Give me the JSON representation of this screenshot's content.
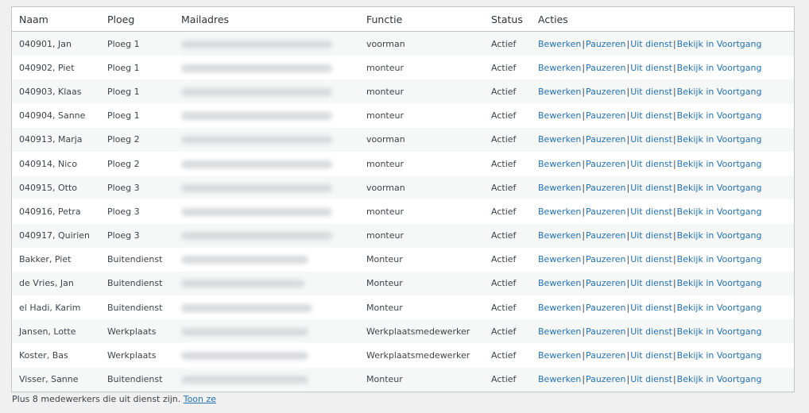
{
  "table": {
    "headers": {
      "naam": "Naam",
      "ploeg": "Ploeg",
      "mail": "Mailadres",
      "functie": "Functie",
      "status": "Status",
      "acties": "Acties"
    },
    "actions": {
      "edit": "Bewerken",
      "pause": "Pauzeren",
      "retire": "Uit dienst",
      "view": "Bekijk in Voortgang",
      "separator": "|"
    },
    "rows": [
      {
        "naam": "040901, Jan",
        "ploeg": "Ploeg 1",
        "functie": "voorman",
        "status": "Actief"
      },
      {
        "naam": "040902, Piet",
        "ploeg": "Ploeg 1",
        "functie": "monteur",
        "status": "Actief"
      },
      {
        "naam": "040903, Klaas",
        "ploeg": "Ploeg 1",
        "functie": "monteur",
        "status": "Actief"
      },
      {
        "naam": "040904, Sanne",
        "ploeg": "Ploeg 1",
        "functie": "monteur",
        "status": "Actief"
      },
      {
        "naam": "040913, Marja",
        "ploeg": "Ploeg 2",
        "functie": "voorman",
        "status": "Actief"
      },
      {
        "naam": "040914, Nico",
        "ploeg": "Ploeg 2",
        "functie": "monteur",
        "status": "Actief"
      },
      {
        "naam": "040915, Otto",
        "ploeg": "Ploeg 3",
        "functie": "voorman",
        "status": "Actief"
      },
      {
        "naam": "040916, Petra",
        "ploeg": "Ploeg 3",
        "functie": "monteur",
        "status": "Actief"
      },
      {
        "naam": "040917, Quirien",
        "ploeg": "Ploeg 3",
        "functie": "monteur",
        "status": "Actief"
      },
      {
        "naam": "Bakker, Piet",
        "ploeg": "Buitendienst",
        "functie": "Monteur",
        "status": "Actief"
      },
      {
        "naam": "de Vries, Jan",
        "ploeg": "Buitendienst",
        "functie": "Monteur",
        "status": "Actief"
      },
      {
        "naam": "el Hadi, Karim",
        "ploeg": "Buitendienst",
        "functie": "Monteur",
        "status": "Actief"
      },
      {
        "naam": "Jansen, Lotte",
        "ploeg": "Werkplaats",
        "functie": "Werkplaatsmedewerker",
        "status": "Actief"
      },
      {
        "naam": "Koster, Bas",
        "ploeg": "Werkplaats",
        "functie": "Werkplaatsmedewerker",
        "status": "Actief"
      },
      {
        "naam": "Visser, Sanne",
        "ploeg": "Buitendienst",
        "functie": "Monteur",
        "status": "Actief"
      }
    ]
  },
  "footer": {
    "text": "Plus 8 medewerkers die uit dienst zijn.",
    "link": "Toon ze"
  },
  "colors": {
    "link": "#2271b1",
    "stripe": "#f6f7f7",
    "border": "#c3c4c7"
  }
}
